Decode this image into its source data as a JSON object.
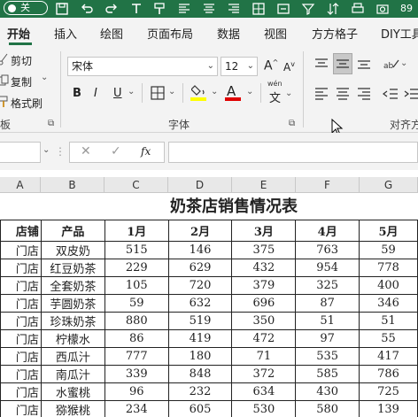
{
  "titlebar": {
    "autosave_state": "关",
    "truncated_text": "89"
  },
  "tabs": [
    "开始",
    "插入",
    "绘图",
    "页面布局",
    "数据",
    "视图",
    "方方格子",
    "DIY工具箱"
  ],
  "clipboard": {
    "cut": "剪切",
    "copy": "复制",
    "format_painter": "格式刷",
    "group_label": "板"
  },
  "font": {
    "name": "宋体",
    "size": "12",
    "bold": "B",
    "italic": "I",
    "underline": "U",
    "grow_a": "A",
    "shrink_a": "A",
    "font_color_a": "A",
    "phonetic": "wén",
    "group_label": "字体",
    "fill_color": "#ffff00",
    "font_color": "#e00000"
  },
  "alignment": {
    "group_label": "对齐方"
  },
  "formula_bar": {
    "fx": "fx"
  },
  "columns": [
    "A",
    "B",
    "C",
    "D",
    "E",
    "F",
    "G"
  ],
  "sheet": {
    "title": "奶茶店销售情况表",
    "headers": [
      "店铺",
      "产品",
      "1月",
      "2月",
      "3月",
      "4月",
      "5月"
    ],
    "rows": [
      [
        "门店",
        "双皮奶",
        "515",
        "146",
        "375",
        "763",
        "59"
      ],
      [
        "门店",
        "红豆奶茶",
        "229",
        "629",
        "432",
        "954",
        "778"
      ],
      [
        "门店",
        "全套奶茶",
        "105",
        "720",
        "379",
        "325",
        "400"
      ],
      [
        "门店",
        "芋圆奶茶",
        "59",
        "632",
        "696",
        "87",
        "346"
      ],
      [
        "门店",
        "珍珠奶茶",
        "880",
        "519",
        "350",
        "51",
        "51"
      ],
      [
        "门店",
        "柠檬水",
        "86",
        "419",
        "472",
        "97",
        "55"
      ],
      [
        "门店",
        "西瓜汁",
        "777",
        "180",
        "71",
        "535",
        "417"
      ],
      [
        "门店",
        "南瓜汁",
        "339",
        "848",
        "372",
        "585",
        "786"
      ],
      [
        "门店",
        "水蜜桃",
        "96",
        "232",
        "634",
        "430",
        "725"
      ],
      [
        "门店",
        "猕猴桃",
        "234",
        "605",
        "530",
        "580",
        "139"
      ]
    ]
  }
}
